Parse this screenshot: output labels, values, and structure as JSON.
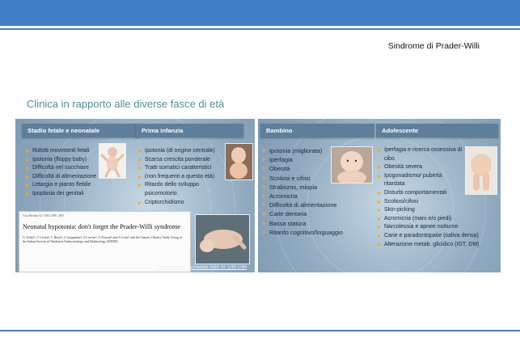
{
  "header": {
    "doc_title": "Sindrome di Prader-Willi"
  },
  "section_title": "Clinica in rapporto alle diverse fasce di età",
  "columns": {
    "fetal": {
      "heading": "Stadio fetale e neonatale",
      "items": [
        "Ridotti movimenti fetali",
        "Ipotonia (floppy baby)",
        "Difficoltà nel succhiare",
        "Difficoltà di alimentazione",
        "Letargia e pianto flebile",
        "Ipoplasia dei genitali"
      ]
    },
    "infancy": {
      "heading": "Prima infanzia",
      "items": [
        "Ipotonia (di origine centrale)",
        "Scarsa crescita ponderale",
        "Tratti somatici caratteristici",
        "(non frequenti a questa età)",
        "Ritardo dello sviluppo psicomotorio",
        "Criptorchidismo"
      ]
    },
    "child": {
      "heading": "Bambino",
      "items": [
        "Ipotonia (migliorata)",
        "Iperfagia",
        "Obesità",
        "Scoliosi e cifosi",
        "Strabismo, miopia",
        "Acromicria",
        "Difficoltà di alimentazione",
        "Carie dentaria",
        "Bassa statura",
        "Ritardo cognitivo/linguaggio"
      ]
    },
    "adolescent": {
      "heading": "Adolescente",
      "items": [
        "Iperfagia e ricerca ossessiva di cibo",
        "Obesità severa",
        "Ipogonadismo/ pubertà ritardata",
        "Disturbi comportamentali",
        "Scoliosi/cifosi",
        "Skin-picking",
        "Acromicria (mani e/o piedi)",
        "Narcolessia e apnee notturne",
        "Carie e paradontopatie (saliva densa)",
        "Alterazione metab. glicidico (IGT, DM)"
      ]
    }
  },
  "article": {
    "meta": "Acta Paediatr 92: 1085–1089. 2003",
    "title": "Neonatal hypotonia: don't forget the Prader-Willi syndrome",
    "authors": "G Trifirò¹, C Livieri², L Bosio³, L Gargantini⁴, A Corrias⁵, G Pozzan⁶ and A Crinò⁷ and the Genetic Obesity Study Group of the Italian Society of Paediatric Endocrinology and Diabetology (SIEDP)"
  },
  "citation": "Trifirò G, et al. Acta Paediatr 2003; 92: 1085-1089",
  "colors": {
    "accent": "#3f7ec4",
    "header_box": "#5d7f9b",
    "bullet": "#f2a81d",
    "title_teal": "#4f8f91"
  }
}
